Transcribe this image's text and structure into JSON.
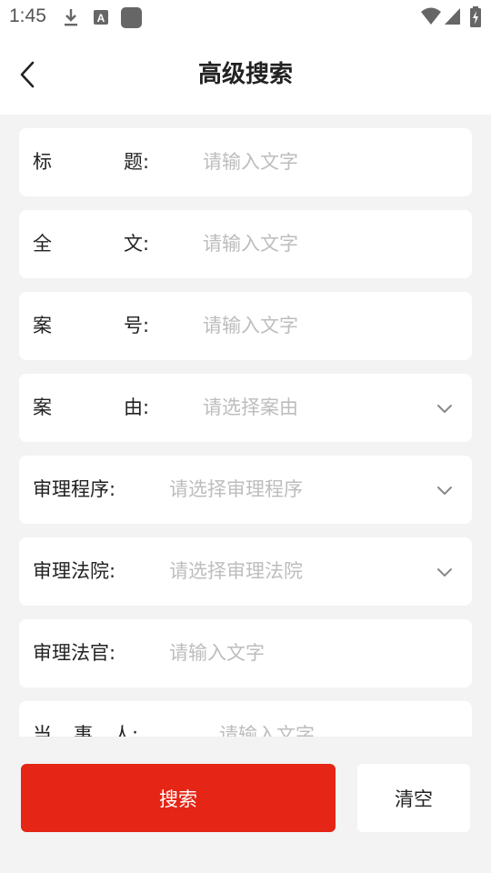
{
  "status_bar": {
    "time": "1:45"
  },
  "header": {
    "title": "高级搜索"
  },
  "form": {
    "title_row": {
      "label_a": "标",
      "label_b": "题:",
      "placeholder": "请输入文字"
    },
    "fulltext_row": {
      "label_a": "全",
      "label_b": "文:",
      "placeholder": "请输入文字"
    },
    "case_no_row": {
      "label_a": "案",
      "label_b": "号:",
      "placeholder": "请输入文字"
    },
    "cause_row": {
      "label_a": "案",
      "label_b": "由:",
      "placeholder": "请选择案由"
    },
    "procedure_row": {
      "label": "审理程序:",
      "placeholder": "请选择审理程序"
    },
    "court_row": {
      "label": "审理法院:",
      "placeholder": "请选择审理法院"
    },
    "judge_row": {
      "label": "审理法官:",
      "placeholder": "请输入文字"
    },
    "party_row": {
      "label_a": "当",
      "label_b": "事",
      "label_c": "人:",
      "placeholder": "请输入文字"
    }
  },
  "actions": {
    "search_label": "搜索",
    "clear_label": "清空"
  },
  "colors": {
    "accent": "#e52515",
    "background": "#f3f3f3"
  },
  "icons": [
    "download-icon",
    "font-a-icon",
    "app-square-icon",
    "wifi-icon",
    "signal-icon",
    "battery-charging-icon",
    "back-arrow-icon",
    "chevron-down-icon"
  ]
}
